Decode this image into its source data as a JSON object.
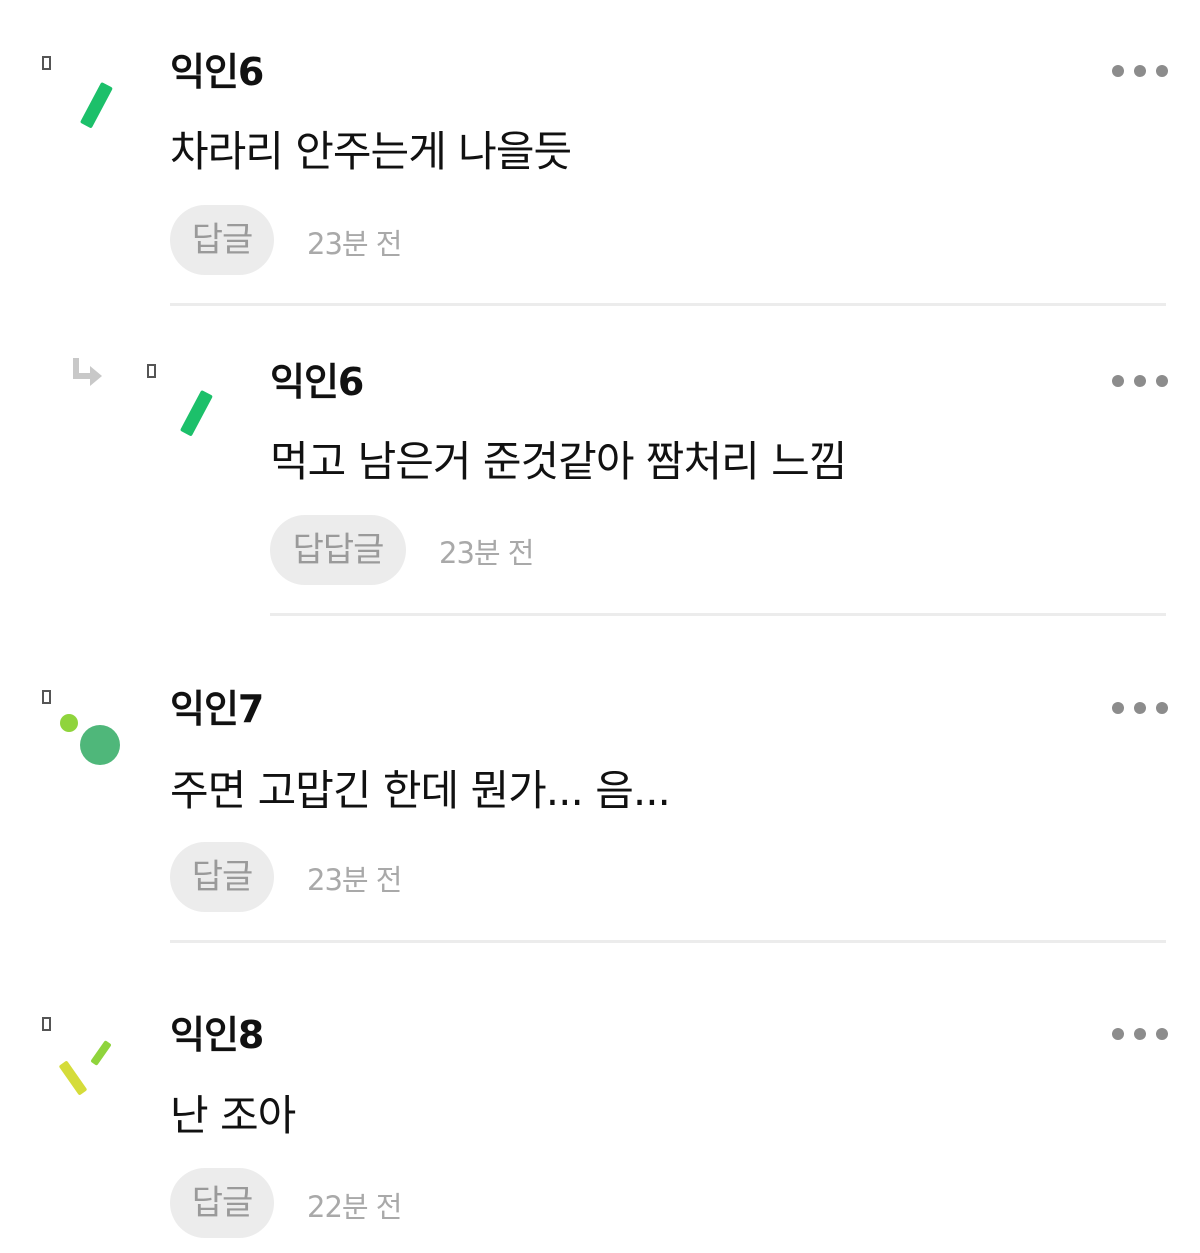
{
  "comments": [
    {
      "author": "익인6",
      "text": "차라리 안주는게 나을듯",
      "reply_label": "답글",
      "time": "23분 전"
    },
    {
      "author": "익인6",
      "text": "먹고 남은거 준것같아 짬처리 느낌",
      "reply_label": "답답글",
      "time": "23분 전"
    },
    {
      "author": "익인7",
      "text": "주면 고맙긴 한데 뭔가... 음...",
      "reply_label": "답글",
      "time": "23분 전"
    },
    {
      "author": "익인8",
      "text": "난 조아",
      "reply_label": "답글",
      "time": "22분 전"
    }
  ],
  "icons": {
    "more": "more-horizontal-icon",
    "reply_arrow": "reply-arrow-icon",
    "broken_image": "broken-image-icon"
  },
  "colors": {
    "avatar_green": "#1cc06a",
    "avatar_green_dot": "#4fb77a",
    "avatar_lime": "#8fd43c",
    "avatar_yellow": "#d5dc3a",
    "muted_text": "#a9a9a9",
    "button_bg": "#ececec"
  }
}
